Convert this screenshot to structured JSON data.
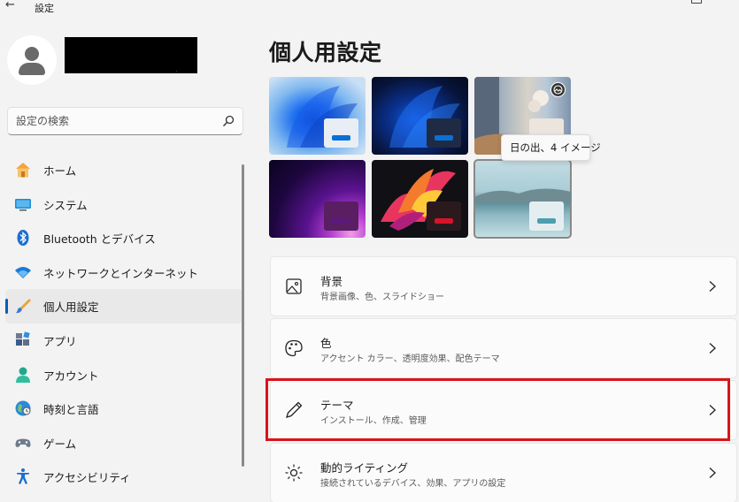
{
  "window": {
    "title": "設定",
    "back_glyph": "←"
  },
  "profile": {
    "redacted_tail": "."
  },
  "search": {
    "placeholder": "設定の検索"
  },
  "nav": {
    "items": [
      {
        "label": "ホーム",
        "icon": "home-icon"
      },
      {
        "label": "システム",
        "icon": "system-icon"
      },
      {
        "label": "Bluetooth とデバイス",
        "icon": "bluetooth-icon"
      },
      {
        "label": "ネットワークとインターネット",
        "icon": "wifi-icon"
      },
      {
        "label": "個人用設定",
        "icon": "brush-icon",
        "active": true
      },
      {
        "label": "アプリ",
        "icon": "apps-icon"
      },
      {
        "label": "アカウント",
        "icon": "account-icon"
      },
      {
        "label": "時刻と言語",
        "icon": "globe-icon"
      },
      {
        "label": "ゲーム",
        "icon": "gamepad-icon"
      },
      {
        "label": "アクセシビリティ",
        "icon": "accessibility-icon"
      }
    ]
  },
  "main": {
    "page_title": "個人用設定",
    "themes": [
      {
        "name": "windows-light",
        "accent": "#0a6fd6"
      },
      {
        "name": "windows-dark",
        "accent": "#0a6fd6"
      },
      {
        "name": "sunrise-slideshow",
        "accent": "#ffffff"
      },
      {
        "name": "glow",
        "accent": "#5b1a7a"
      },
      {
        "name": "captured-motion",
        "accent": "#d6142a"
      },
      {
        "name": "flow",
        "accent": "#4d9eaf",
        "selected": true
      }
    ],
    "tooltip": "日の出、4 イメージ",
    "cards": [
      {
        "title": "背景",
        "subtitle": "背景画像、色、スライドショー",
        "icon": "image-icon"
      },
      {
        "title": "色",
        "subtitle": "アクセント カラー、透明度効果、配色テーマ",
        "icon": "palette-icon"
      },
      {
        "title": "テーマ",
        "subtitle": "インストール、作成、管理",
        "icon": "pen-icon",
        "highlighted": true
      },
      {
        "title": "動的ライティング",
        "subtitle": "接続されているデバイス、効果、アプリの設定",
        "icon": "lighting-icon"
      }
    ]
  },
  "colors": {
    "accent": "#005fb8",
    "highlight": "#d9141b",
    "background": "#f3f3f3"
  }
}
